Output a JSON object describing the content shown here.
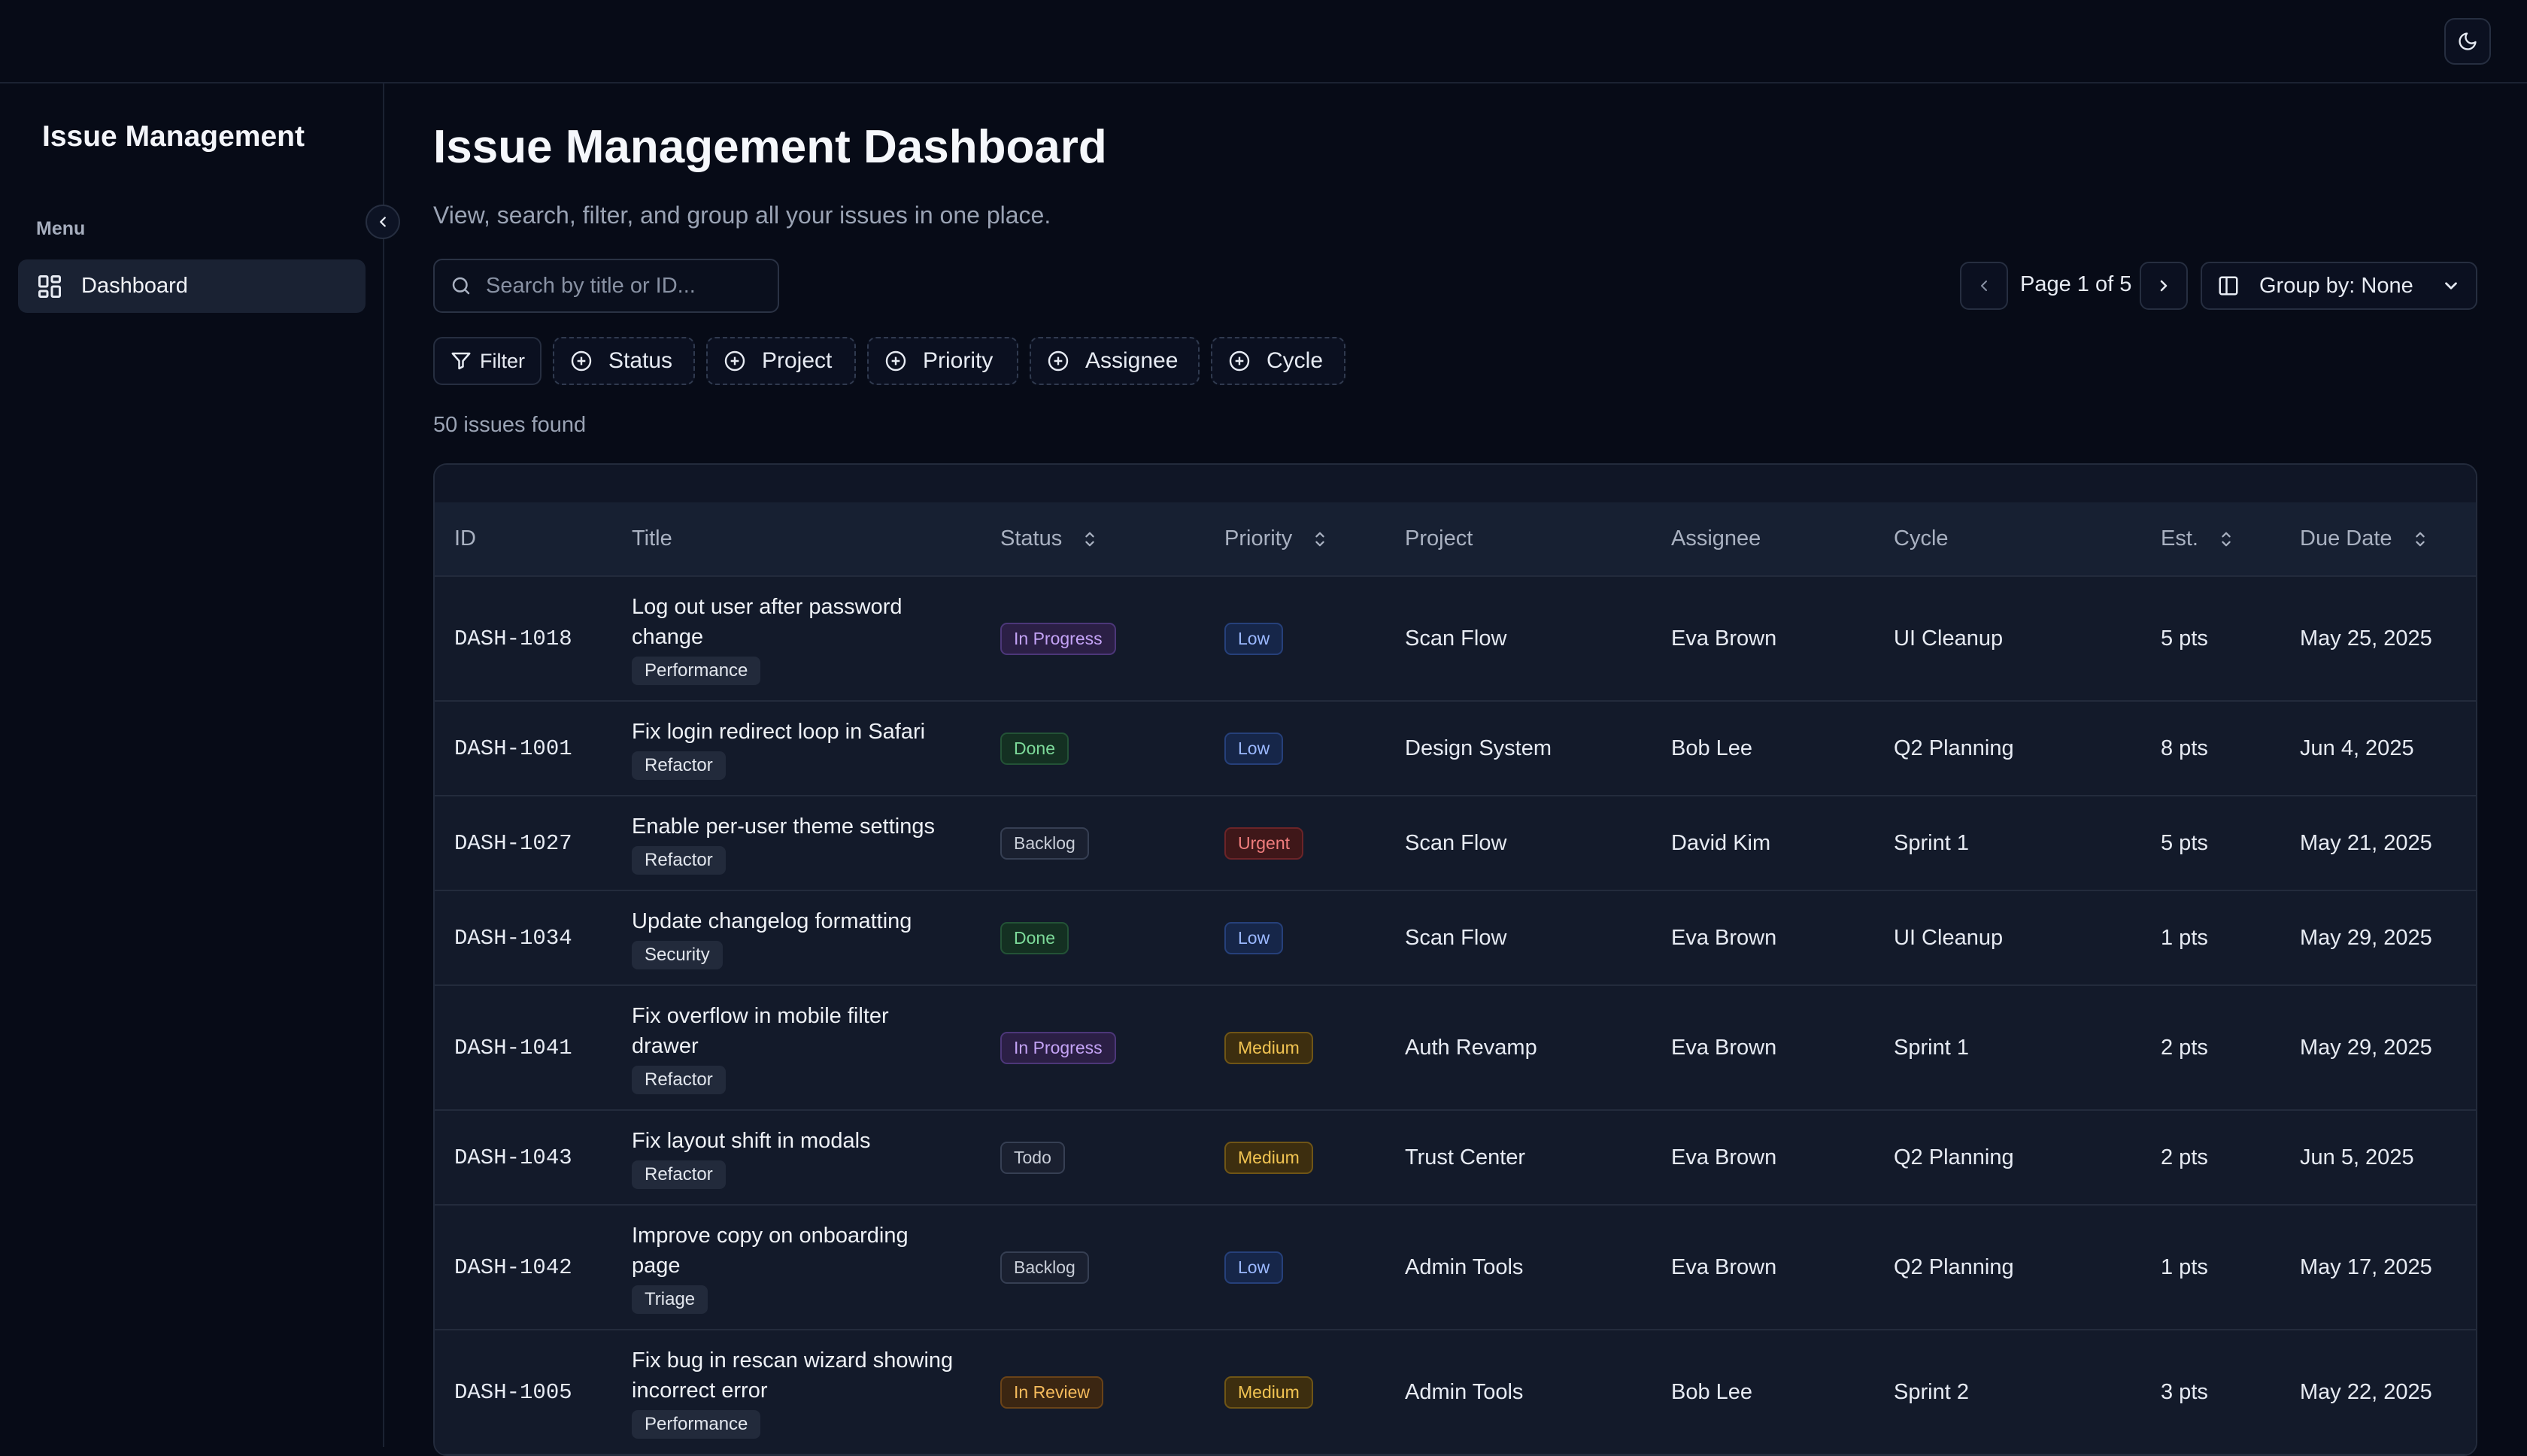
{
  "sidebar": {
    "app_title": "Issue Management",
    "menu_label": "Menu",
    "items": [
      {
        "label": "Dashboard",
        "icon": "dashboard-grid-icon",
        "active": true
      }
    ]
  },
  "header": {
    "theme_toggle_icon": "moon-icon"
  },
  "main": {
    "title": "Issue Management Dashboard",
    "subtitle": "View, search, filter, and group all your issues in one place.",
    "search": {
      "placeholder": "Search by title or ID...",
      "value": ""
    },
    "pagination": {
      "label": "Page 1 of 5",
      "current": 1,
      "total": 5
    },
    "group_by": {
      "label": "Group by: None"
    },
    "filters": {
      "filter_label": "Filter",
      "chips": [
        "Status",
        "Project",
        "Priority",
        "Assignee",
        "Cycle"
      ]
    },
    "count_text": "50 issues found"
  },
  "table": {
    "columns": [
      "ID",
      "Title",
      "Status",
      "Priority",
      "Project",
      "Assignee",
      "Cycle",
      "Est.",
      "Due Date"
    ],
    "rows": [
      {
        "id": "DASH-1018",
        "title": [
          "Log out user after password",
          "change"
        ],
        "tag": "Performance",
        "status": "In Progress",
        "priority": "Low",
        "project": "Scan Flow",
        "assignee": "Eva Brown",
        "cycle": "UI Cleanup",
        "est": "5 pts",
        "due": "May 25, 2025"
      },
      {
        "id": "DASH-1001",
        "title": [
          "Fix login redirect loop in Safari"
        ],
        "tag": "Refactor",
        "status": "Done",
        "priority": "Low",
        "project": "Design System",
        "assignee": "Bob Lee",
        "cycle": "Q2 Planning",
        "est": "8 pts",
        "due": "Jun 4, 2025"
      },
      {
        "id": "DASH-1027",
        "title": [
          "Enable per-user theme settings"
        ],
        "tag": "Refactor",
        "status": "Backlog",
        "priority": "Urgent",
        "project": "Scan Flow",
        "assignee": "David Kim",
        "cycle": "Sprint 1",
        "est": "5 pts",
        "due": "May 21, 2025"
      },
      {
        "id": "DASH-1034",
        "title": [
          "Update changelog formatting"
        ],
        "tag": "Security",
        "status": "Done",
        "priority": "Low",
        "project": "Scan Flow",
        "assignee": "Eva Brown",
        "cycle": "UI Cleanup",
        "est": "1 pts",
        "due": "May 29, 2025"
      },
      {
        "id": "DASH-1041",
        "title": [
          "Fix overflow in mobile filter",
          "drawer"
        ],
        "tag": "Refactor",
        "status": "In Progress",
        "priority": "Medium",
        "project": "Auth Revamp",
        "assignee": "Eva Brown",
        "cycle": "Sprint 1",
        "est": "2 pts",
        "due": "May 29, 2025"
      },
      {
        "id": "DASH-1043",
        "title": [
          "Fix layout shift in modals"
        ],
        "tag": "Refactor",
        "status": "Todo",
        "priority": "Medium",
        "project": "Trust Center",
        "assignee": "Eva Brown",
        "cycle": "Q2 Planning",
        "est": "2 pts",
        "due": "Jun 5, 2025"
      },
      {
        "id": "DASH-1042",
        "title": [
          "Improve copy on onboarding",
          "page"
        ],
        "tag": "Triage",
        "status": "Backlog",
        "priority": "Low",
        "project": "Admin Tools",
        "assignee": "Eva Brown",
        "cycle": "Q2 Planning",
        "est": "1 pts",
        "due": "May 17, 2025"
      },
      {
        "id": "DASH-1005",
        "title": [
          "Fix bug in rescan wizard showing",
          "incorrect error"
        ],
        "tag": "Performance",
        "status": "In Review",
        "priority": "Medium",
        "project": "Admin Tools",
        "assignee": "Bob Lee",
        "cycle": "Sprint 2",
        "est": "3 pts",
        "due": "May 22, 2025"
      }
    ]
  }
}
